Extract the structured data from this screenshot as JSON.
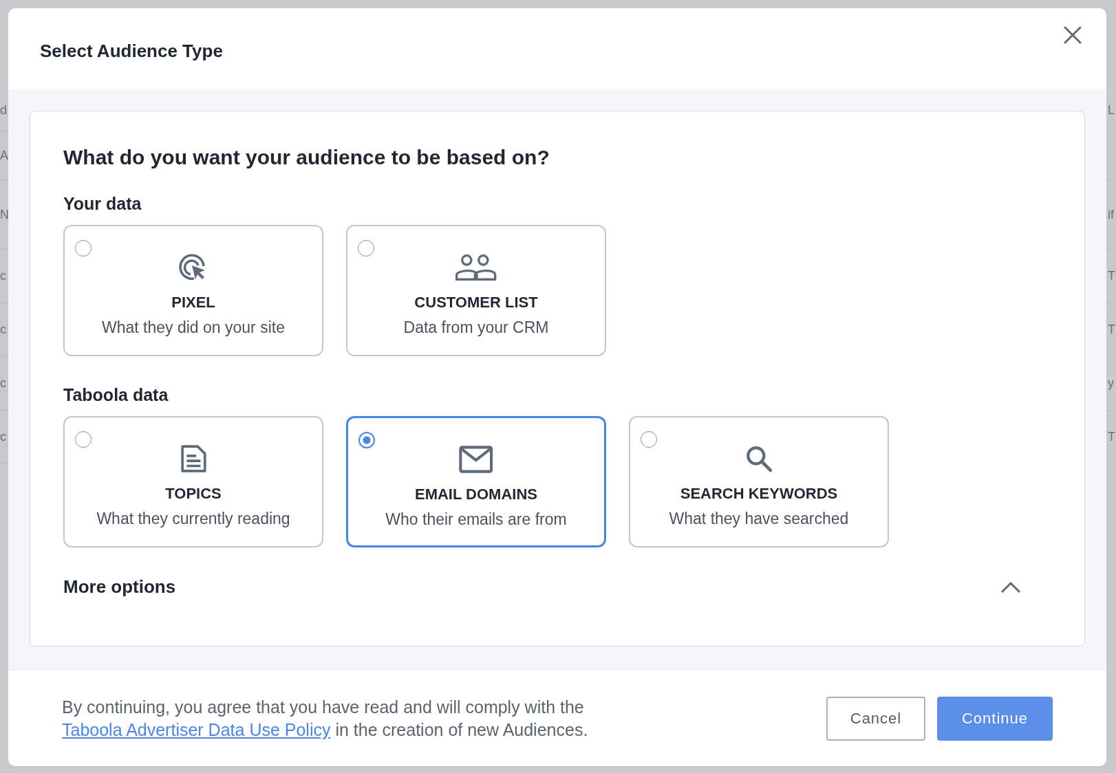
{
  "background_page": {
    "rows": [
      {
        "left": "d",
        "right": "L"
      },
      {
        "left": "A"
      },
      {
        "left": "N",
        "right": "if"
      },
      {
        "left": "c",
        "right": "T"
      },
      {
        "left": "c",
        "right": "T"
      },
      {
        "left": "c",
        "right": "y"
      },
      {
        "left": "c",
        "right": "T"
      }
    ]
  },
  "dialog": {
    "title": "Select Audience Type",
    "question": "What do you want your audience to be based on?",
    "sections": [
      {
        "title": "Your data",
        "options": [
          {
            "kind": "pixel",
            "title": "PIXEL",
            "description": "What they did on your site",
            "selected": false
          },
          {
            "kind": "list",
            "title": "CUSTOMER LIST",
            "description": "Data from your CRM",
            "selected": false
          }
        ]
      },
      {
        "title": "Taboola data",
        "options": [
          {
            "kind": "topics",
            "title": "TOPICS",
            "description": "What they currently reading",
            "selected": false
          },
          {
            "kind": "email",
            "title": "EMAIL DOMAINS",
            "description": "Who their emails are from",
            "selected": true
          },
          {
            "kind": "search",
            "title": "SEARCH KEYWORDS",
            "description": "What they have searched",
            "selected": false
          }
        ]
      }
    ],
    "more_options": {
      "label": "More options",
      "expanded": true
    },
    "consent": {
      "before": "By continuing, you agree that you have read and will comply with the",
      "link": "Taboola Advertiser Data Use Policy",
      "after": "in the creation of new Audiences."
    },
    "buttons": [
      {
        "label": "Cancel",
        "kind": "secondary"
      },
      {
        "label": "Continue",
        "kind": "primary"
      }
    ]
  }
}
